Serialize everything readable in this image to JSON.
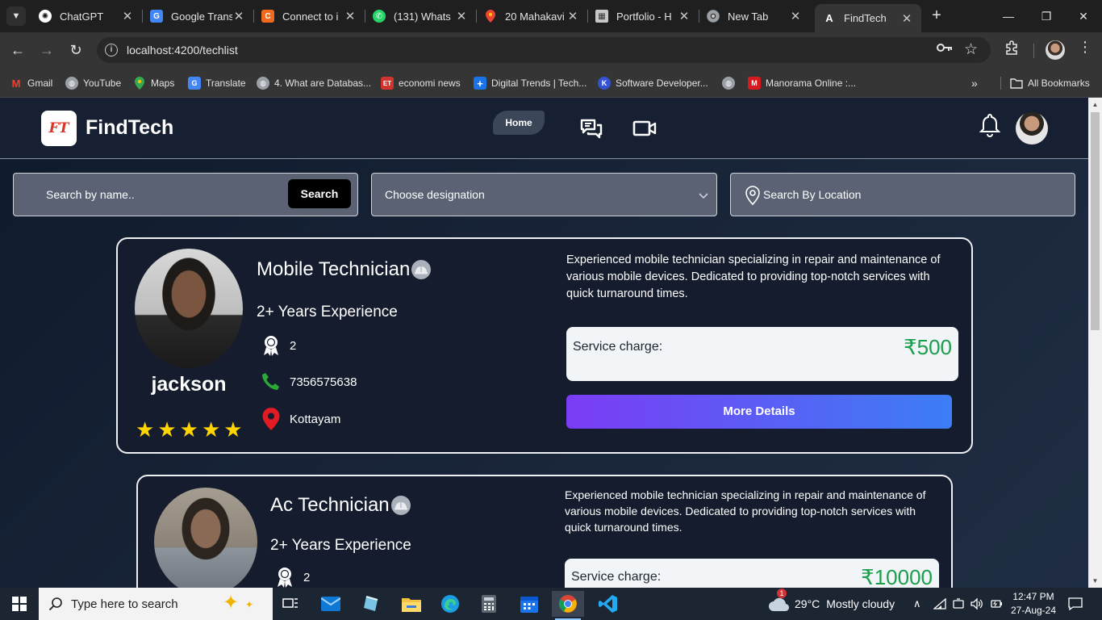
{
  "browser": {
    "tabs": [
      {
        "title": "ChatGPT",
        "icon": "chatgpt-icon",
        "color": "#ffffff"
      },
      {
        "title": "Google Trans",
        "icon": "google-translate-icon",
        "color": "#4285f4"
      },
      {
        "title": "Connect to i",
        "icon": "connect-icon",
        "color": "#f06a1d"
      },
      {
        "title": "(131) Whats",
        "icon": "whatsapp-icon",
        "color": "#25d366"
      },
      {
        "title": "20 Mahakavi",
        "icon": "maps-pin-icon",
        "color": "#34a853"
      },
      {
        "title": "Portfolio - H",
        "icon": "portfolio-icon",
        "color": "#c7c7c7"
      },
      {
        "title": "New Tab",
        "icon": "chrome-icon",
        "color": "#e3e3e3"
      },
      {
        "title": "FindTech",
        "icon": "angular-icon",
        "color": "#ffffff"
      }
    ],
    "url": "localhost:4200/techlist",
    "bookmarks": [
      {
        "label": "Gmail",
        "icon": "gmail-icon",
        "color": "#ea4335"
      },
      {
        "label": "YouTube",
        "icon": "globe-icon",
        "color": "#9aa0a6"
      },
      {
        "label": "Maps",
        "icon": "maps-icon",
        "color": "#34a853"
      },
      {
        "label": "Translate",
        "icon": "translate-icon",
        "color": "#4285f4"
      },
      {
        "label": "4. What are Databas...",
        "icon": "globe-icon",
        "color": "#9aa0a6"
      },
      {
        "label": "economi news",
        "icon": "et-icon",
        "color": "#d0342c"
      },
      {
        "label": "Digital Trends | Tech...",
        "icon": "plus-icon",
        "color": "#1a73e8"
      },
      {
        "label": "Software Developer...",
        "icon": "k-icon",
        "color": "#3451d1"
      },
      {
        "label": "",
        "icon": "globe-icon",
        "color": "#9aa0a6"
      },
      {
        "label": "Manorama Online :...",
        "icon": "manorama-icon",
        "color": "#d71920"
      }
    ],
    "all_bookmarks": "All Bookmarks"
  },
  "app": {
    "logo_text": "FT",
    "brand": "FindTech",
    "nav_home": "Home",
    "filters": {
      "search_placeholder": "Search by name..",
      "search_button": "Search",
      "designation_placeholder": "Choose designation",
      "location_placeholder": "Search By Location"
    },
    "technicians": [
      {
        "name": "jackson",
        "title": "Mobile Technician",
        "experience": "2+ Years Experience",
        "rating_stars": 5,
        "stars": [
          "★",
          "★",
          "★",
          "★",
          "★"
        ],
        "awards": "2",
        "phone": "7356575638",
        "location": "Kottayam",
        "description": "Experienced mobile technician specializing in repair and maintenance of various mobile devices. Dedicated to providing top-notch services with quick turnaround times.",
        "charge_label": "Service charge:",
        "charge_value": "₹500",
        "button": "More Details"
      },
      {
        "name": "",
        "title": "Ac Technician",
        "experience": "2+ Years Experience",
        "awards": "2",
        "description": "Experienced mobile technician specializing in repair and maintenance of various mobile devices. Dedicated to providing top-notch services with quick turnaround times.",
        "charge_label": "Service charge:",
        "charge_value": "₹10000"
      }
    ]
  },
  "taskbar": {
    "search_placeholder": "Type here to search",
    "weather_temp": "29°C",
    "weather_text": "Mostly cloudy",
    "weather_badge": "1",
    "time": "12:47 PM",
    "date": "27-Aug-24"
  },
  "colors": {
    "accent_gradient_start": "#7b3cf5",
    "accent_gradient_end": "#3c7ef5",
    "star": "#ffd400",
    "price": "#1a9e4c",
    "phone_icon": "#2aa838",
    "location_icon": "#e01b24"
  }
}
